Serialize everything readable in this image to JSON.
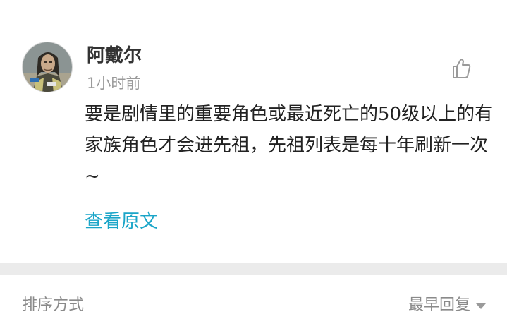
{
  "comment": {
    "username": "阿戴尔",
    "time": "1小时前",
    "text": "要是剧情里的重要角色或最近死亡的50级以上的有家族角色才会进先祖，先祖列表是每十年刷新一次~",
    "view_original": "查看原文",
    "like_icon": "thumbs-up-icon"
  },
  "sort": {
    "label": "排序方式",
    "selected": "最早回复",
    "dropdown_icon": "caret-down-icon"
  }
}
